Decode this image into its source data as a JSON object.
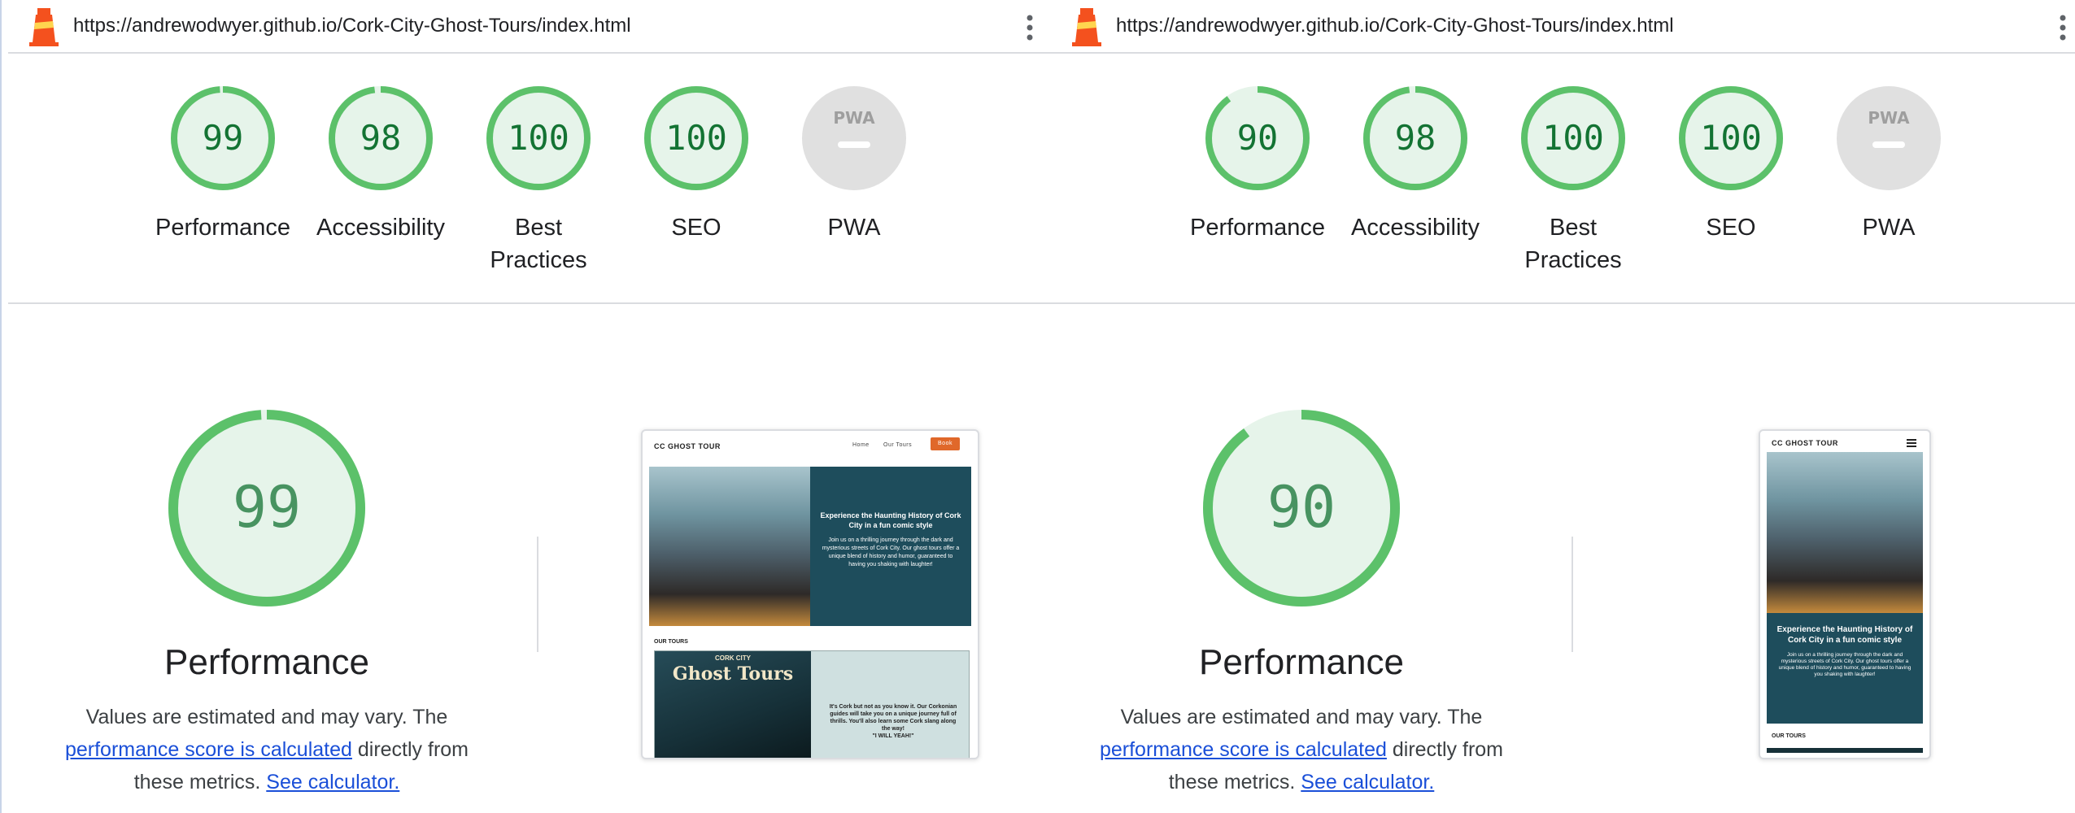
{
  "left": {
    "url": "https://andrewodwyer.github.io/Cork-City-Ghost-Tours/index.html",
    "scores": [
      {
        "label": "Performance",
        "value": "99",
        "pct": 0.99
      },
      {
        "label": "Accessibility",
        "value": "98",
        "pct": 0.98
      },
      {
        "label": "Best Practices",
        "value": "100",
        "pct": 1.0
      },
      {
        "label": "SEO",
        "value": "100",
        "pct": 1.0
      },
      {
        "label": "PWA",
        "value": "PWA",
        "pct": 0
      }
    ],
    "big": {
      "value": "99",
      "pct": 0.99,
      "title": "Performance"
    },
    "desc": {
      "pre": "Values are estimated and may vary. The ",
      "link1": "performance score is calculated",
      "mid": " directly from these metrics. ",
      "link2": "See calculator."
    },
    "screenshot": {
      "brand": "CC GHOST TOUR",
      "nav": [
        "Home",
        "Our Tours",
        "Book"
      ],
      "hero_heading": "Experience the Haunting History of Cork City in a fun comic style",
      "hero_text": "Join us on a thrilling journey through the dark and mysterious streets of Cork City. Our ghost tours offer a unique blend of history and humor, guaranteed to having you shaking with laughter!",
      "tours_label": "OUR TOURS",
      "poster_line1": "CORK CITY",
      "poster_line2": "Ghost Tours",
      "tour_text": "It's Cork but not as you know it. Our Corkonian guides will take you on a unique journey full of thrills. You'll also learn some Cork slang along the way!",
      "tour_quote": "\"I WILL YEAH!\""
    }
  },
  "right": {
    "url": "https://andrewodwyer.github.io/Cork-City-Ghost-Tours/index.html",
    "scores": [
      {
        "label": "Performance",
        "value": "90",
        "pct": 0.9
      },
      {
        "label": "Accessibility",
        "value": "98",
        "pct": 0.98
      },
      {
        "label": "Best Practices",
        "value": "100",
        "pct": 1.0
      },
      {
        "label": "SEO",
        "value": "100",
        "pct": 1.0
      },
      {
        "label": "PWA",
        "value": "PWA",
        "pct": 0
      }
    ],
    "big": {
      "value": "90",
      "pct": 0.9,
      "title": "Performance"
    },
    "desc": {
      "pre": "Values are estimated and may vary. The ",
      "link1": "performance score is calculated",
      "mid": " directly from these metrics. ",
      "link2": "See calculator."
    },
    "screenshot": {
      "brand": "CC GHOST TOUR",
      "hero_heading": "Experience the Haunting History of Cork City in a fun comic style",
      "hero_text": "Join us on a thrilling journey through the dark and mysterious streets of Cork City. Our ghost tours offer a unique blend of history and humor, guaranteed to having you shaking with laughter!",
      "tours_label": "OUR TOURS"
    }
  },
  "colors": {
    "pass": "#0cce6b",
    "pass_ring": "#5cc16a",
    "pass_text": "#137333",
    "pass_fill": "#e6f4ea",
    "pwa_grey": "#e0e0e0",
    "link": "#1a4fd8"
  }
}
